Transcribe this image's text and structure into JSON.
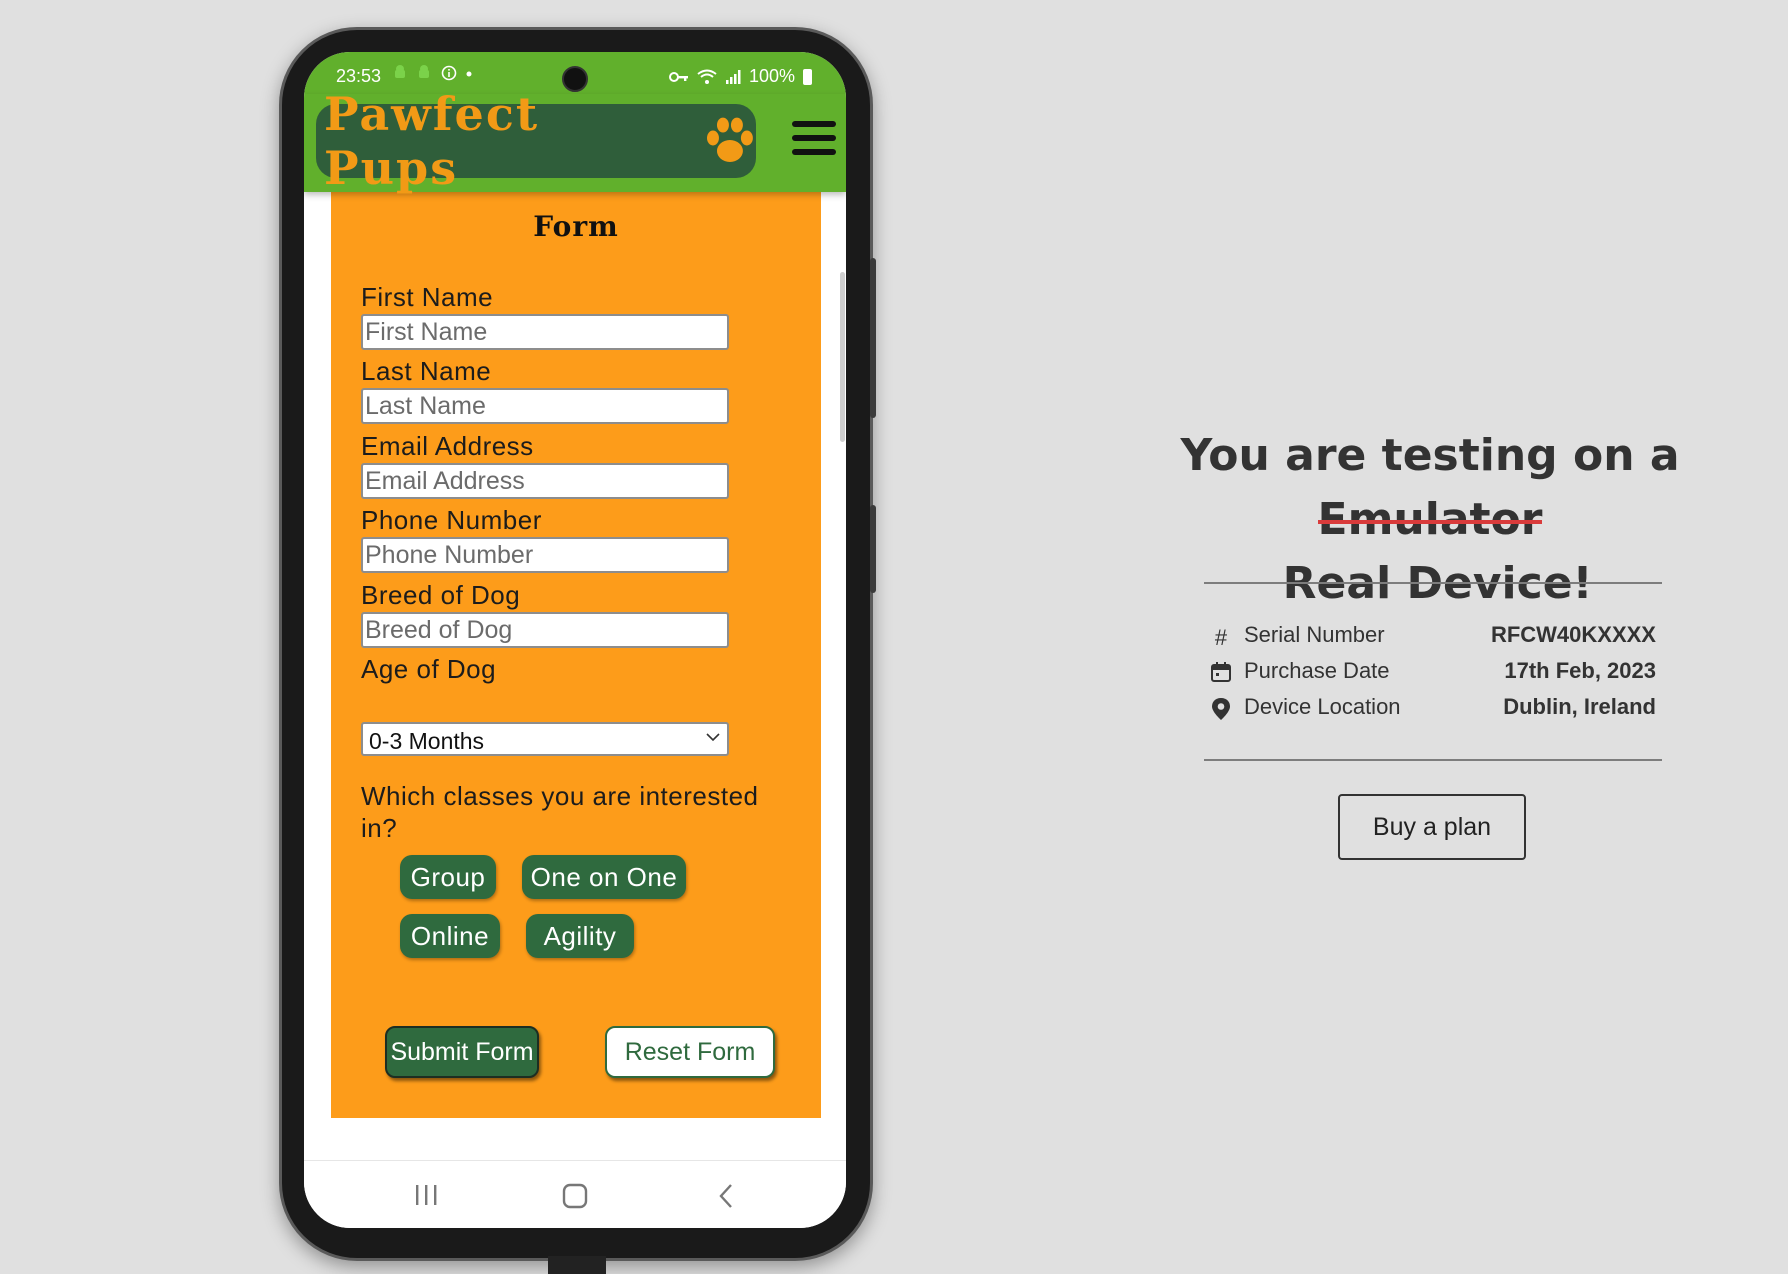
{
  "status_bar": {
    "time": "23:53",
    "battery": "100%"
  },
  "app": {
    "logo_text": "Pawfect Pups",
    "form_title": "Form",
    "fields": [
      {
        "label": "First Name",
        "placeholder": "First Name"
      },
      {
        "label": "Last Name",
        "placeholder": "Last Name"
      },
      {
        "label": "Email Address",
        "placeholder": "Email Address"
      },
      {
        "label": "Phone Number",
        "placeholder": "Phone Number"
      },
      {
        "label": "Breed of Dog",
        "placeholder": "Breed of Dog"
      }
    ],
    "age": {
      "label": "Age of Dog",
      "selected": "0-3 Months"
    },
    "classes_question": "Which classes you are interested in?",
    "classes": [
      "Group",
      "One on One",
      "Online",
      "Agility"
    ],
    "submit_label": "Submit Form",
    "reset_label": "Reset Form",
    "colors": {
      "header_green": "#61b02c",
      "logo_bg": "#2f5e3a",
      "logo_orange": "#f29a16",
      "form_orange": "#fd9c1a",
      "button_green": "#2f6a3e"
    }
  },
  "panel": {
    "headline_line1": "You are testing on a",
    "headline_struck": "Emulator",
    "headline_rest": " Real Device!",
    "rows": [
      {
        "icon": "hash-icon",
        "label": "Serial Number",
        "value": "RFCW40KXXXX"
      },
      {
        "icon": "calendar-icon",
        "label": "Purchase Date",
        "value": "17th Feb, 2023"
      },
      {
        "icon": "location-pin-icon",
        "label": "Device Location",
        "value": "Dublin, Ireland"
      }
    ],
    "buy_label": "Buy a plan",
    "strike_color": "#d93b3b"
  }
}
